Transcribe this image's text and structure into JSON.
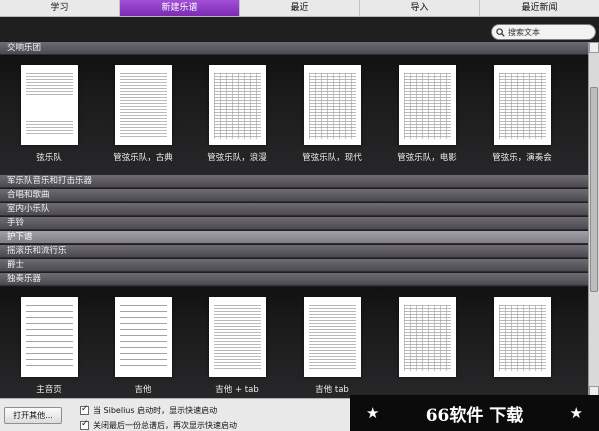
{
  "tabs": [
    {
      "label": "学习",
      "active": false
    },
    {
      "label": "新建乐谱",
      "active": true
    },
    {
      "label": "最近",
      "active": false
    },
    {
      "label": "导入",
      "active": false
    },
    {
      "label": "最近新闻",
      "active": false
    }
  ],
  "search": {
    "placeholder": "搜索文本"
  },
  "categories": [
    {
      "label": "交响乐团",
      "selected": false
    },
    {
      "label": "军乐队音乐和打击乐器",
      "selected": false
    },
    {
      "label": "合唱和歌曲",
      "selected": false
    },
    {
      "label": "室内小乐队",
      "selected": false
    },
    {
      "label": "手铃",
      "selected": false
    },
    {
      "label": "护下谱",
      "selected": true
    },
    {
      "label": "摇滚乐和流行乐",
      "selected": false
    },
    {
      "label": "爵士",
      "selected": false
    },
    {
      "label": "独奏乐器",
      "selected": false
    }
  ],
  "orchestra_templates": [
    {
      "label": "弦乐队"
    },
    {
      "label": "管弦乐队，古典"
    },
    {
      "label": "管弦乐队，浪漫"
    },
    {
      "label": "管弦乐队，现代"
    },
    {
      "label": "管弦乐队，电影"
    },
    {
      "label": "管弦乐，演奏会"
    }
  ],
  "solo_templates": [
    {
      "label": "主音页"
    },
    {
      "label": "吉他"
    },
    {
      "label": "吉他 + tab"
    },
    {
      "label": "吉他 tab"
    },
    {
      "label": ""
    },
    {
      "label": ""
    }
  ],
  "footer": {
    "open_button": "打开其他...",
    "option1": "当 Sibelius 启动时，显示快速启动",
    "option2": "关闭最后一份总谱后，再次显示快速启动"
  },
  "watermark": {
    "text": "66软件 下载",
    "star": "★"
  }
}
